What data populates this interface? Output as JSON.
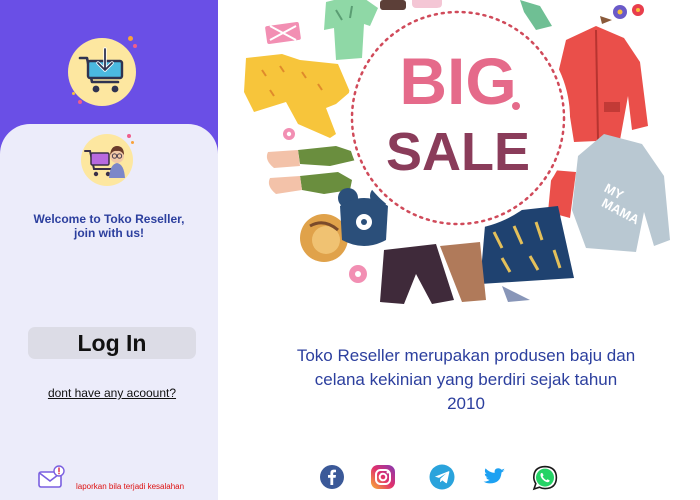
{
  "left_panel": {
    "welcome_text": "Welcome to Toko Reseller, join with us!",
    "login_button_label": "Log In",
    "signup_link_text": "dont have any acoount?",
    "report_text": "laporkan bila terjadi kesalahan"
  },
  "banner": {
    "line1": "BIG",
    "line2": "SALE",
    "shirt_text_line1": "MY",
    "shirt_text_line2": "MAMA"
  },
  "description": "Toko Reseller merupakan produsen baju dan celana kekinian yang berdiri sejak tahun 2010",
  "social_links": [
    {
      "name": "facebook",
      "icon": "facebook-icon"
    },
    {
      "name": "instagram",
      "icon": "instagram-icon"
    },
    {
      "name": "telegram",
      "icon": "telegram-icon"
    },
    {
      "name": "twitter",
      "icon": "twitter-icon"
    },
    {
      "name": "whatsapp",
      "icon": "whatsapp-icon"
    }
  ],
  "colors": {
    "panel_purple": "#6a4fe6",
    "card_background": "#ececfa",
    "text_blue": "#2c3f9e",
    "sale_pink": "#e56a8a",
    "sale_plum": "#8a3c5a",
    "report_red": "#d11111"
  }
}
